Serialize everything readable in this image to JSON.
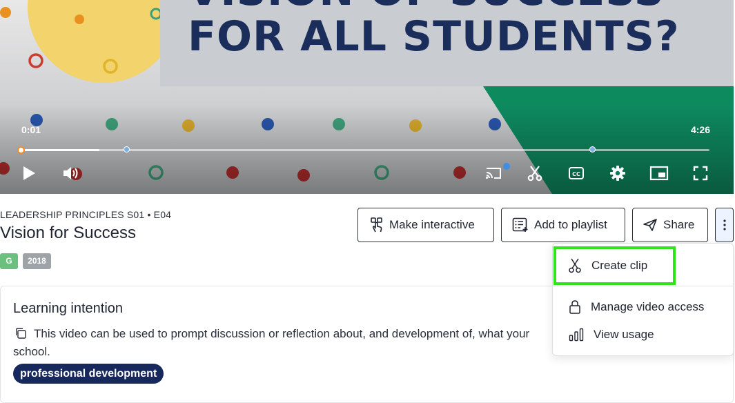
{
  "player": {
    "slide_text_top": "VISION OF SUCCESS",
    "slide_text": "FOR ALL STUDENTS?",
    "current_time": "0:01",
    "total_time": "4:26",
    "progress_fraction": 0.114,
    "controls": [
      "play-icon",
      "volume-icon",
      "cast-icon",
      "scissors-icon",
      "captions-icon",
      "settings-icon",
      "picture-in-picture-icon",
      "fullscreen-icon"
    ],
    "captions_label": "CC"
  },
  "video": {
    "series": "LEADERSHIP PRINCIPLES S01 • E04",
    "title": "Vision for Success",
    "rating": "G",
    "year": "2018"
  },
  "actions": {
    "make_interactive": "Make interactive",
    "add_to_playlist": "Add to playlist",
    "share": "Share"
  },
  "menu": {
    "create_clip": "Create clip",
    "manage_access": "Manage video access",
    "view_usage": "View usage"
  },
  "description": {
    "heading": "Learning intention",
    "text": "This video can be used to prompt discussion or reflection about, and development of, what your school.",
    "tag": "professional development"
  },
  "colors": {
    "highlight": "#2ee41b",
    "tag_bg": "#17285c",
    "rating_badge": "#6cc07f",
    "year_badge": "#9ea3a8",
    "progress_handle": "#f08a24",
    "slide_green": "#0e8a5f"
  }
}
